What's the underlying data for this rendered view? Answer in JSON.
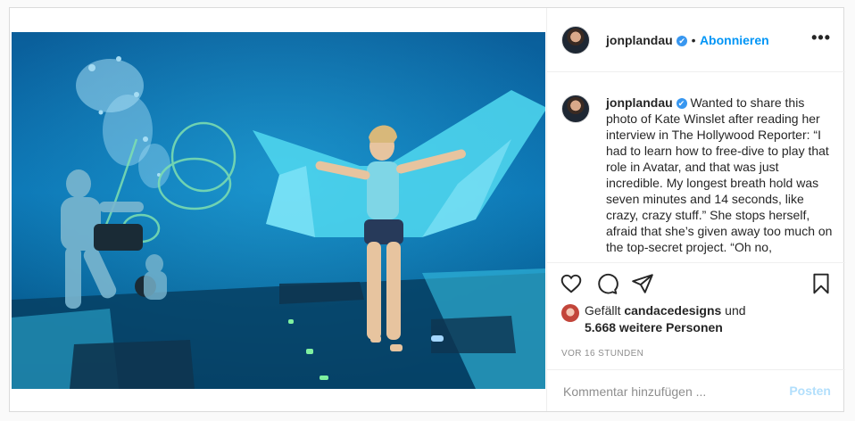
{
  "post": {
    "username": "jonplandau",
    "verified_badge": "✔",
    "dot": "•",
    "follow_label": "Abonnieren",
    "more_label": "•••",
    "caption_username": "jonplandau",
    "caption_text": "Wanted to share this photo of Kate Winslet after reading her interview in The Hollywood Reporter: “I had to learn how to free-dive to play that role in Avatar, and that was just incredible. My longest breath hold was seven minutes and 14 seconds, like crazy, crazy stuff.” She stops herself, afraid that she’s given away too much on the top-secret project. “Oh no,",
    "icons": {
      "like": "heart-icon",
      "comment": "comment-icon",
      "share": "paper-plane-icon",
      "save": "bookmark-icon"
    },
    "likes": {
      "prefix": "Gefällt ",
      "liker_name": "candacedesigns",
      "middle": " und",
      "others": "5.668 weitere Personen"
    },
    "timestamp": "VOR 16 STUNDEN",
    "comment_placeholder": "Kommentar hinzufügen ...",
    "post_button": "Posten",
    "colors": {
      "accent": "#0095f6",
      "post_disabled": "#b2dffc",
      "water": "#0a6fae"
    }
  }
}
